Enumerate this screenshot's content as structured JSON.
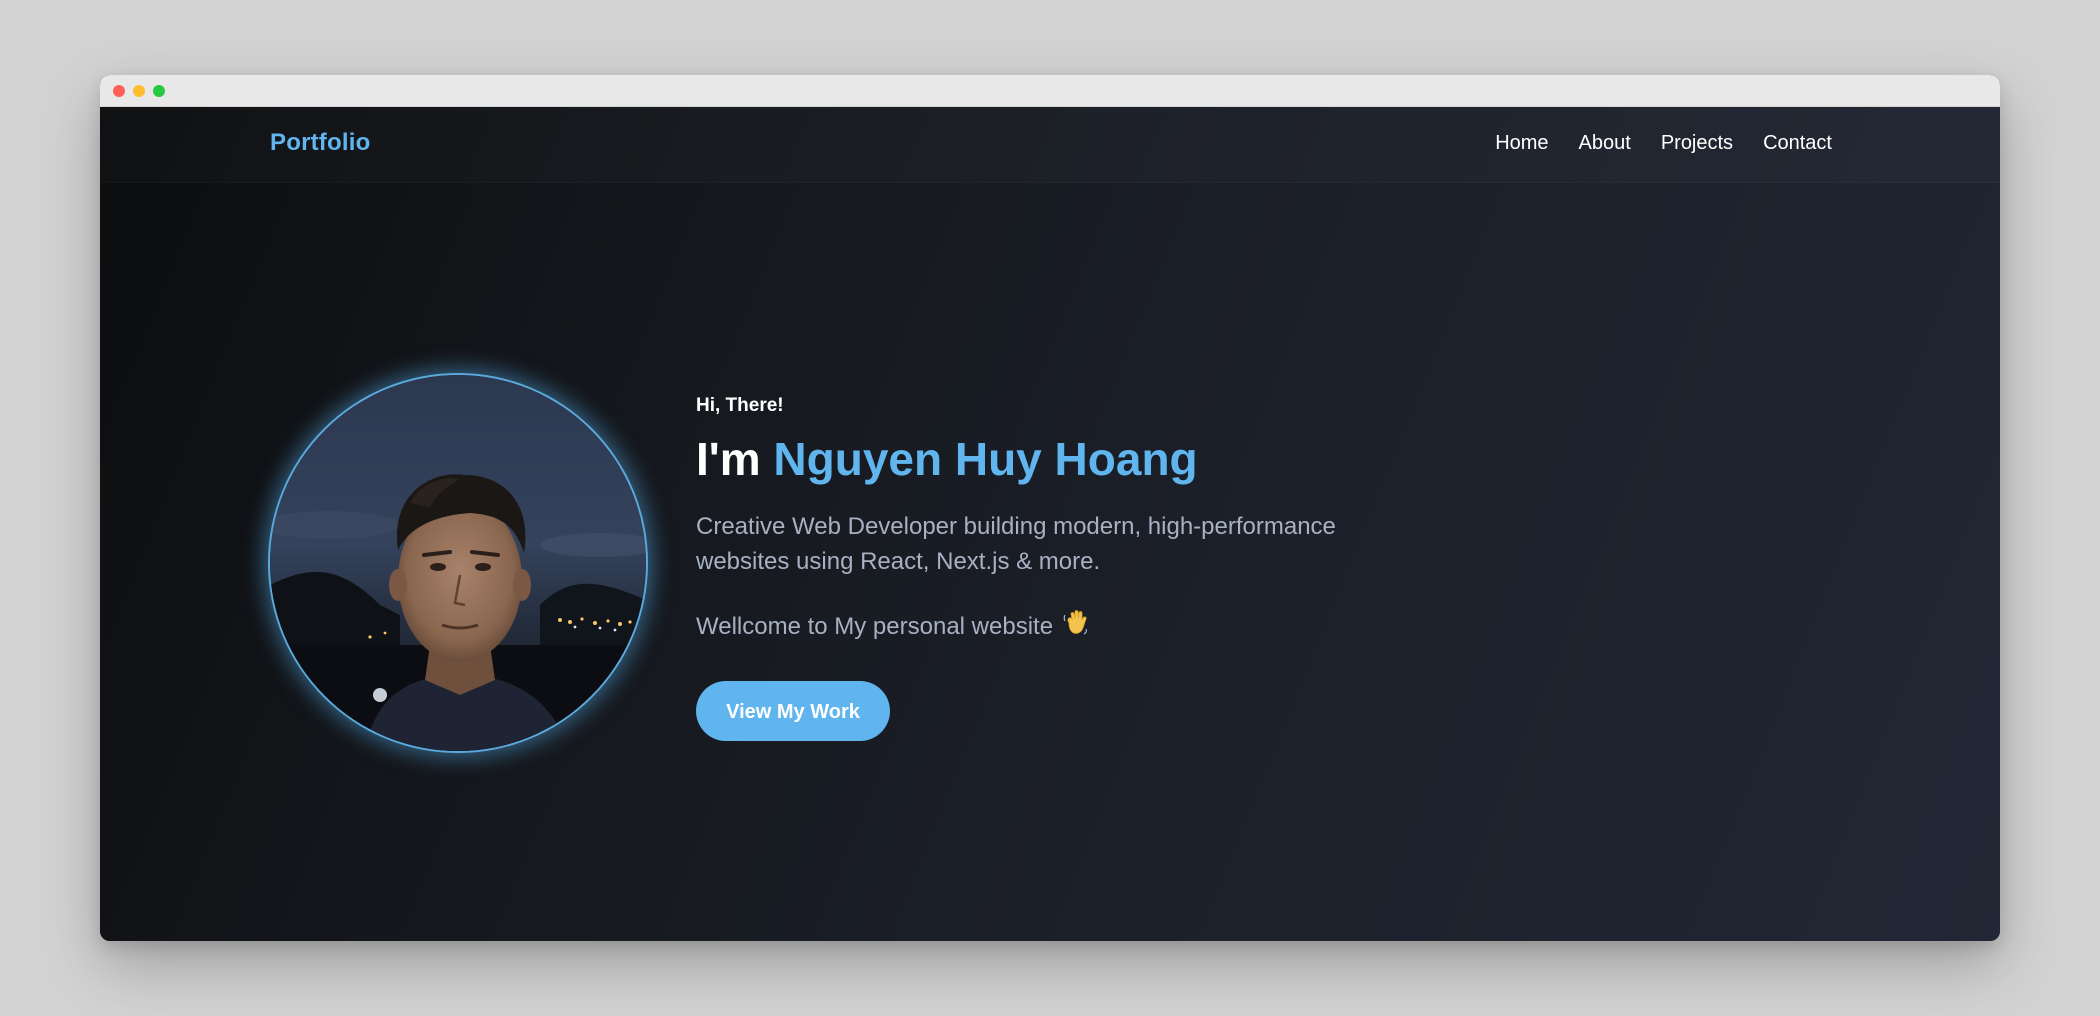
{
  "navbar": {
    "logo": "Portfolio",
    "links": [
      "Home",
      "About",
      "Projects",
      "Contact"
    ]
  },
  "hero": {
    "greeting": "Hi, There!",
    "headline_prefix": "I'm ",
    "name": "Nguyen Huy Hoang",
    "tagline": "Creative Web Developer building modern, high-performance websites using React, Next.js & more.",
    "welcome": "Wellcome to My personal website",
    "welcome_emoji": "waving-hand-icon",
    "cta_label": "View My Work"
  },
  "colors": {
    "accent": "#60b5ef",
    "background_dark": "#111317",
    "text_muted": "#a7b1c2"
  }
}
